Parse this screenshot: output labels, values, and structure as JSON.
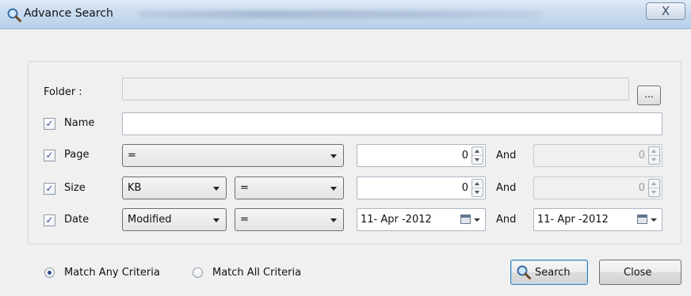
{
  "window": {
    "title": "Advance Search",
    "close_label": "X"
  },
  "folder": {
    "label": "Folder :",
    "value": "",
    "browse_label": "..."
  },
  "name": {
    "label": "Name",
    "checked": true,
    "value": ""
  },
  "page": {
    "label": "Page",
    "checked": true,
    "operator": "=",
    "value_from": "0",
    "and_label": "And",
    "value_to": "0"
  },
  "size": {
    "label": "Size",
    "checked": true,
    "unit": "KB",
    "operator": "=",
    "value_from": "0",
    "and_label": "And",
    "value_to": "0"
  },
  "date": {
    "label": "Date",
    "checked": true,
    "kind": "Modified",
    "operator": "=",
    "date_from": "11- Apr -2012",
    "and_label": "And",
    "date_to": "11- Apr -2012"
  },
  "match": {
    "any_label": "Match Any Criteria",
    "all_label": "Match All Criteria",
    "selected": "any"
  },
  "buttons": {
    "search_label": "Search",
    "close_label": "Close"
  },
  "colors": {
    "titlebar": "#c9dbef",
    "accent": "#2d4f8e",
    "check": "#2a4f96"
  }
}
